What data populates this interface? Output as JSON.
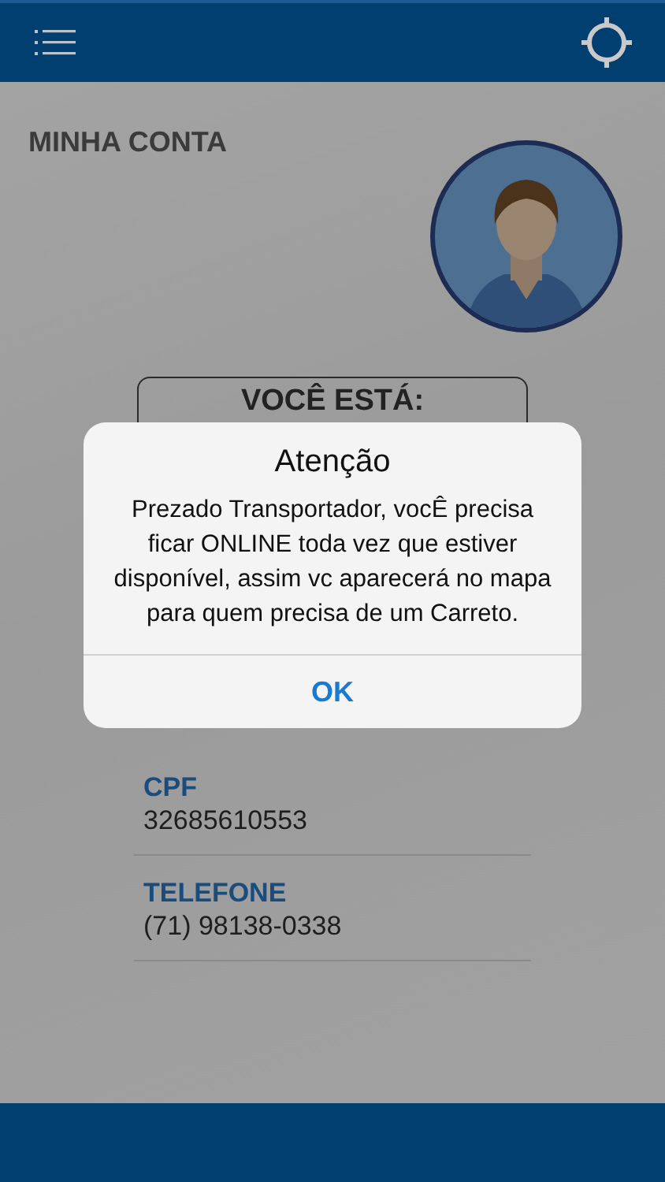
{
  "page_title": "MINHA CONTA",
  "status_box": {
    "label": "VOCÊ ESTÁ:"
  },
  "fields": [
    {
      "label": "CPF",
      "value": "32685610553"
    },
    {
      "label": "TELEFONE",
      "value": "(71) 98138-0338"
    }
  ],
  "dialog": {
    "title": "Atenção",
    "message": "Prezado Transportador, vocÊ precisa ficar ONLINE toda vez que estiver disponível, assim vc aparecerá no mapa para quem precisa de um Carreto.",
    "buttons": [
      "OK"
    ]
  }
}
